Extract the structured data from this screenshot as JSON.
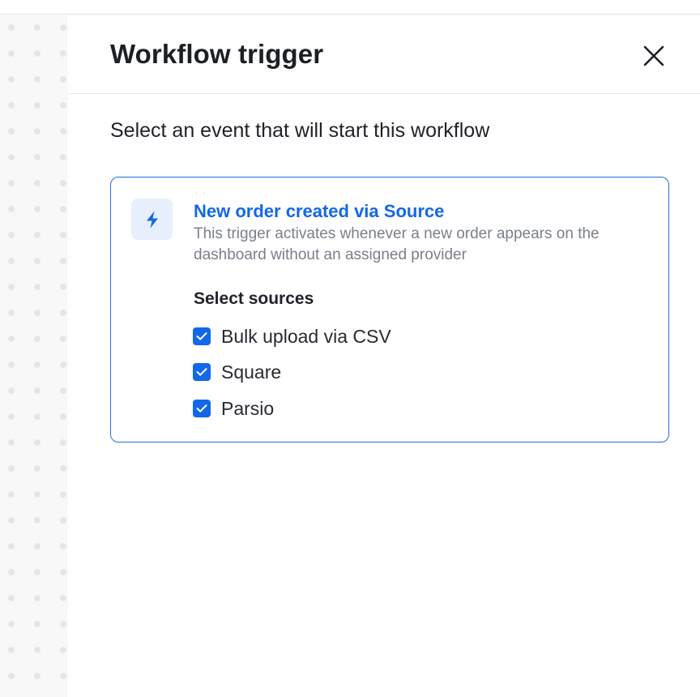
{
  "panel": {
    "title": "Workflow trigger",
    "close_icon": "close-icon"
  },
  "subtitle": "Select an event that will start this workflow",
  "trigger": {
    "icon": "lightning-bolt-icon",
    "title": "New order created via Source",
    "description": "This trigger activates whenever a new order appears on the dashboard without an assigned provider",
    "selected": true
  },
  "sources": {
    "heading": "Select sources",
    "items": [
      {
        "label": "Bulk upload via CSV",
        "checked": true
      },
      {
        "label": "Square",
        "checked": true
      },
      {
        "label": "Parsio",
        "checked": true
      }
    ]
  },
  "colors": {
    "accent": "#1467e6",
    "card_border": "#1f6fe5",
    "icon_bg": "#e7effc",
    "title_text": "#1c1f26",
    "muted_text": "#7a7f8a"
  }
}
